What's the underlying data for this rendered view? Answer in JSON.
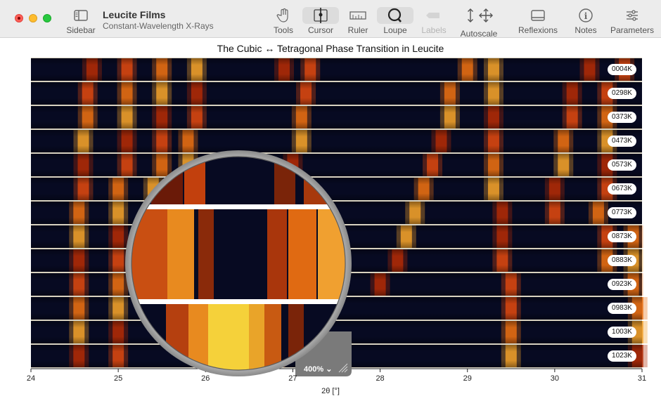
{
  "window": {
    "title": "Leucite Films",
    "subtitle": "Constant-Wavelength X-Rays"
  },
  "toolbar": {
    "sidebar": "Sidebar",
    "tools": "Tools",
    "cursor": "Cursor",
    "ruler": "Ruler",
    "loupe": "Loupe",
    "labels": "Labels",
    "autoscale": "Autoscale",
    "reflexions": "Reflexions",
    "notes": "Notes",
    "parameters": "Parameters"
  },
  "loupe_zoom": "400%",
  "chart_data": {
    "type": "heatmap",
    "title": "The Cubic ↔ Tetragonal Phase Transition in Leucite",
    "xlabel": "2θ [°]",
    "xlim": [
      24,
      31
    ],
    "xticks": [
      "24",
      "25",
      "26",
      "27",
      "28",
      "29",
      "30",
      "31"
    ],
    "series": [
      {
        "name": "0004K",
        "peaks": [
          24.7,
          25.1,
          25.5,
          25.9,
          26.9,
          27.2,
          29.0,
          29.3,
          30.4,
          30.8
        ]
      },
      {
        "name": "0298K",
        "peaks": [
          24.65,
          25.1,
          25.5,
          25.9,
          27.15,
          28.8,
          29.3,
          30.2,
          30.6
        ]
      },
      {
        "name": "0373K",
        "peaks": [
          24.65,
          25.1,
          25.5,
          25.9,
          27.1,
          28.8,
          29.3,
          30.2,
          30.6
        ]
      },
      {
        "name": "0473K",
        "peaks": [
          24.6,
          25.1,
          25.5,
          25.8,
          27.1,
          28.7,
          29.3,
          30.1,
          30.6
        ]
      },
      {
        "name": "0573K",
        "peaks": [
          24.6,
          25.1,
          25.5,
          25.8,
          27.0,
          28.6,
          29.3,
          30.1,
          30.6
        ]
      },
      {
        "name": "0673K",
        "peaks": [
          24.6,
          25.0,
          25.4,
          25.8,
          26.9,
          28.5,
          29.3,
          30.0,
          30.6
        ]
      },
      {
        "name": "0773K",
        "peaks": [
          24.55,
          25.0,
          25.4,
          25.7,
          26.9,
          28.4,
          29.4,
          30.0,
          30.5
        ]
      },
      {
        "name": "0873K",
        "peaks": [
          24.55,
          25.0,
          25.3,
          26.8,
          28.3,
          29.4,
          30.6,
          30.9
        ]
      },
      {
        "name": "0883K",
        "peaks": [
          24.55,
          25.0,
          25.3,
          26.8,
          28.2,
          29.4,
          30.6,
          30.9
        ]
      },
      {
        "name": "0923K",
        "peaks": [
          24.55,
          25.0,
          26.8,
          28.0,
          29.5,
          30.9
        ]
      },
      {
        "name": "0983K",
        "peaks": [
          24.55,
          25.0,
          26.8,
          29.5,
          30.95
        ]
      },
      {
        "name": "1003K",
        "peaks": [
          24.55,
          25.0,
          26.8,
          29.5,
          30.95
        ]
      },
      {
        "name": "1023K",
        "peaks": [
          24.55,
          25.0,
          26.8,
          29.5,
          30.95
        ]
      }
    ]
  }
}
